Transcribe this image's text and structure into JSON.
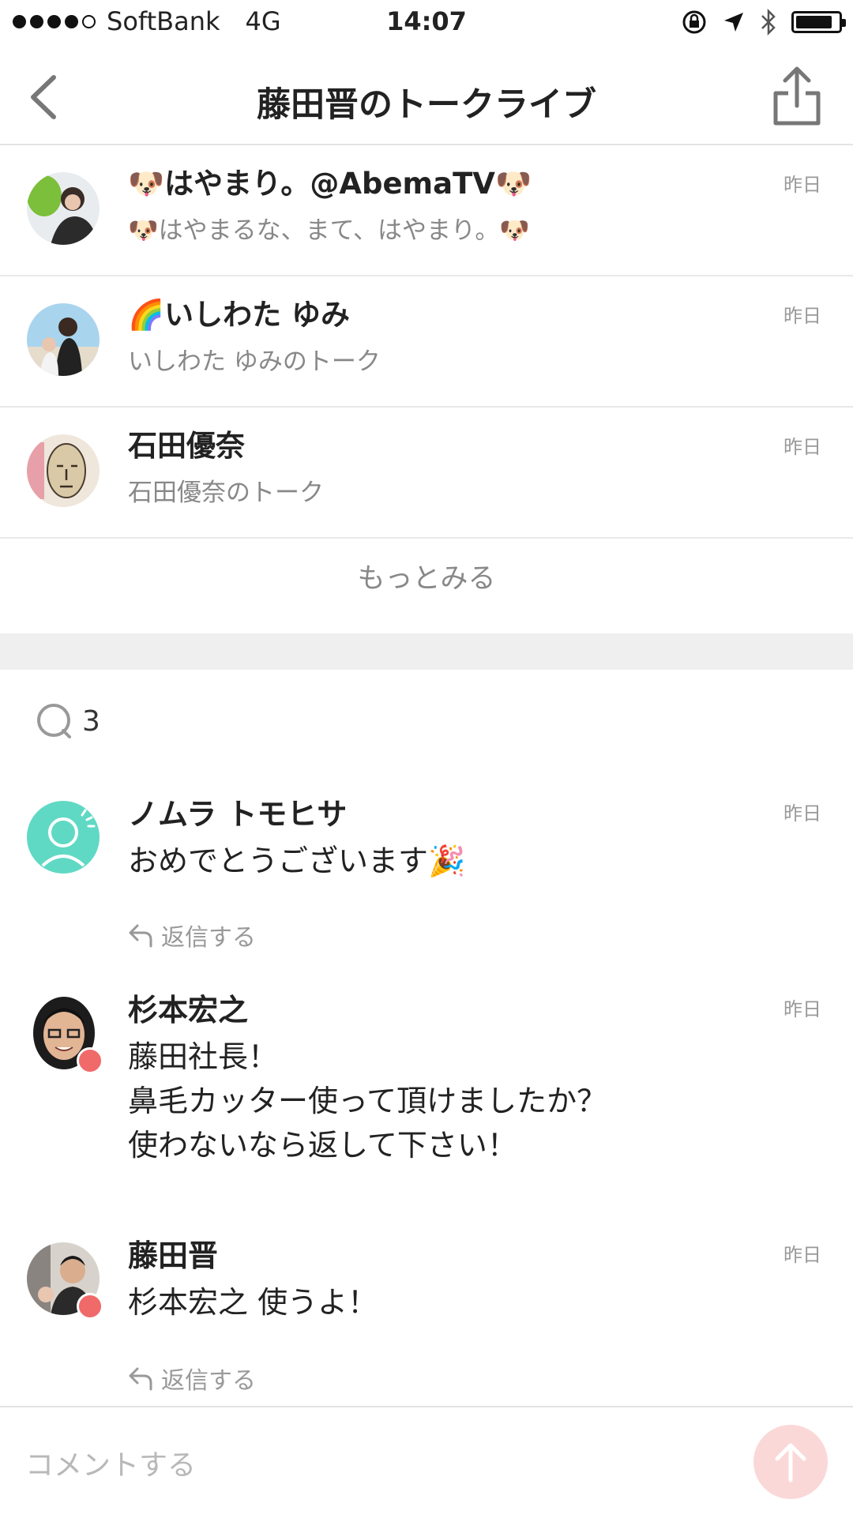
{
  "status_bar": {
    "carrier": "SoftBank",
    "network": "4G",
    "time": "14:07"
  },
  "header": {
    "title": "藤田晋のトークライブ"
  },
  "talks": [
    {
      "name": "🐶はやまり。@AbemaTV🐶",
      "subtitle": "🐶はやまるな、まて、はやまり。🐶",
      "date": "昨日"
    },
    {
      "name": "🌈いしわた ゆみ",
      "subtitle": "いしわた ゆみのトーク",
      "date": "昨日"
    },
    {
      "name": "石田優奈",
      "subtitle": "石田優奈のトーク",
      "date": "昨日"
    }
  ],
  "more_label": "もっとみる",
  "comments_section": {
    "count": "3",
    "comments": [
      {
        "name": "ノムラ トモヒサ",
        "date": "昨日",
        "body": "おめでとうございます🎉",
        "reply_label": "返信する"
      },
      {
        "name": "杉本宏之",
        "date": "昨日",
        "body": "藤田社長！\n鼻毛カッター使って頂けましたか？\n使わないなら返して下さい！"
      },
      {
        "name": "藤田晋",
        "date": "昨日",
        "body": "杉本宏之 使うよ！",
        "reply_label": "返信する"
      }
    ]
  },
  "footer": {
    "comment_placeholder": "コメントする"
  },
  "colors": {
    "accent": "#f06a6a",
    "send_button": "#fbd8d8",
    "teal_avatar": "#5fd9c4"
  }
}
